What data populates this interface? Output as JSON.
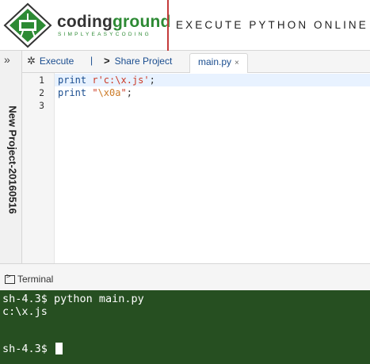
{
  "header": {
    "logo_part1": "coding",
    "logo_part2": "ground",
    "logo_tagline": "SIMPLYEASYCODING",
    "title": "EXECUTE PYTHON ONLINE",
    "colors": {
      "brand_green": "#2d8a34",
      "divider_red": "#c43b3b"
    }
  },
  "sidebar": {
    "toggle_icon": "double-chevron-right-icon",
    "project_name": "New Project-20160516"
  },
  "toolbar": {
    "execute_label": "Execute",
    "execute_icon": "gears-icon",
    "separator": "|",
    "share_label": "Share Project",
    "share_icon": "share-arrow-icon",
    "tab_label": "main.py",
    "tab_close": "×"
  },
  "editor": {
    "line_numbers": [
      "1",
      "2",
      "3"
    ],
    "lines": [
      {
        "kw": "print",
        "str": " r'c:\\x.js'",
        "rest": ";"
      },
      {
        "kw": "print",
        "str_open": " \"",
        "esc": "\\x0a",
        "str_close": "\"",
        "rest": ";"
      },
      {
        "kw": "",
        "rest": ""
      }
    ]
  },
  "terminal": {
    "tab_label": "Terminal",
    "lines": [
      "sh-4.3$ python main.py",
      "c:\\x.js",
      "",
      "sh-4.3$ "
    ],
    "bg_color": "#264f21"
  }
}
